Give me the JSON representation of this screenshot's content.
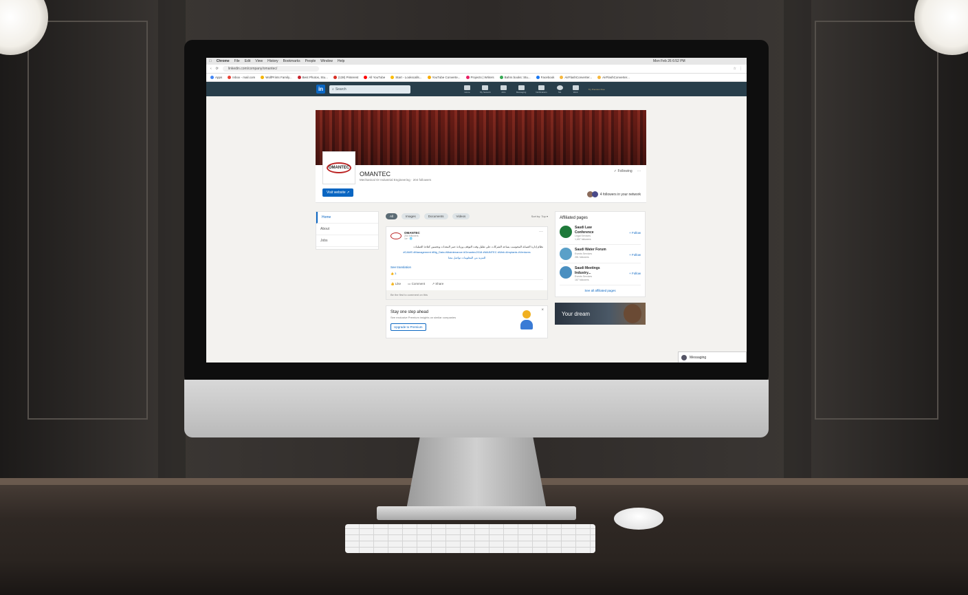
{
  "mac_menu": {
    "app": "Chrome",
    "items": [
      "File",
      "Edit",
      "View",
      "History",
      "Bookmarks",
      "People",
      "Window",
      "Help"
    ],
    "clock": "Mon Feb 26 6:52 PM"
  },
  "browser": {
    "url": "linkedin.com/company/omantec/",
    "bookmarks": [
      "Apps",
      "Inbox - mail.com",
      "WolfPrints Family...",
      "Best Photos, Stu...",
      "(138) Pinterest",
      "All YouTube",
      "Start - Lookscalls...",
      "YouTube Converte...",
      "Projects | Writers",
      "Bahrs books: Stu...",
      "Facebook",
      "AirFlashConverter...",
      "AirFlashConverter..."
    ],
    "bookmark_colors": [
      "#4285f4",
      "#ea4335",
      "#f4b400",
      "#c8232c",
      "#d93025",
      "#ff0000",
      "#fbbc04",
      "#f9ab00",
      "#e91e63",
      "#34a853",
      "#1877f2",
      "#f6b73c",
      "#f6b73c"
    ]
  },
  "linkedin_nav": {
    "logo": "in",
    "search_placeholder": "Search",
    "items": [
      "Home",
      "My Network",
      "Jobs",
      "Messaging",
      "Notifications",
      "Me",
      "Work",
      "Try Premium Free"
    ]
  },
  "company": {
    "name": "OMANTEC",
    "logo_text": "OMANTEC",
    "subtitle": "Mechanical Or Industrial Engineering · 204 followers",
    "following_label": "✓ Following",
    "more": "···",
    "visit_website": "Visit website ↗",
    "network_text": "4 followers in your network"
  },
  "left_nav": [
    "Home",
    "About",
    "Jobs"
  ],
  "filters": {
    "chips": [
      "All",
      "Images",
      "Documents",
      "Videos"
    ],
    "sort_label": "Sort by: Top ▾"
  },
  "post": {
    "author": "OMANTEC",
    "followers": "204 followers",
    "time": "1w · 🌐",
    "more": "···",
    "body": "نظام إدارة الصيانة المحوسب يساعد الشركات على تقليل وقت التوقف وزيادة عمر المعدات وتحسين كفاءة العمليات",
    "tags": "#CAMS #Management #Big_Data #Maintenance #Omantec2018 #MAINTEC #Web #Implants #Ventures",
    "tags2": "للمزيد من المعلومات تواصل معنا",
    "see_translation": "See translation",
    "reactions": "👍 3",
    "actions": [
      "Like",
      "Comment",
      "Share"
    ],
    "comment_prompt": "Be the first to comment on this"
  },
  "promo": {
    "title": "Stay one step ahead",
    "subtitle": "See exclusive Premium insights on similar companies",
    "button": "Upgrade to Premium",
    "close": "×"
  },
  "affiliated": {
    "title": "Affiliated pages",
    "items": [
      {
        "name": "Saudi Law Conference",
        "sub1": "Legal Services",
        "sub2": "1,657 followers",
        "follow": "+ Follow",
        "color": "#1e7a3a"
      },
      {
        "name": "Saudi Water Forum",
        "sub1": "Events Services",
        "sub2": "281 followers",
        "follow": "+ Follow",
        "color": "#5aa0c8"
      },
      {
        "name": "Saudi Meetings Industry...",
        "sub1": "Events Services",
        "sub2": "167 followers",
        "follow": "+ Follow",
        "color": "#4a8fc0"
      }
    ],
    "see_all": "See all affiliated pages"
  },
  "ad": {
    "text": "Your dream"
  },
  "messaging": {
    "label": "Messaging"
  }
}
